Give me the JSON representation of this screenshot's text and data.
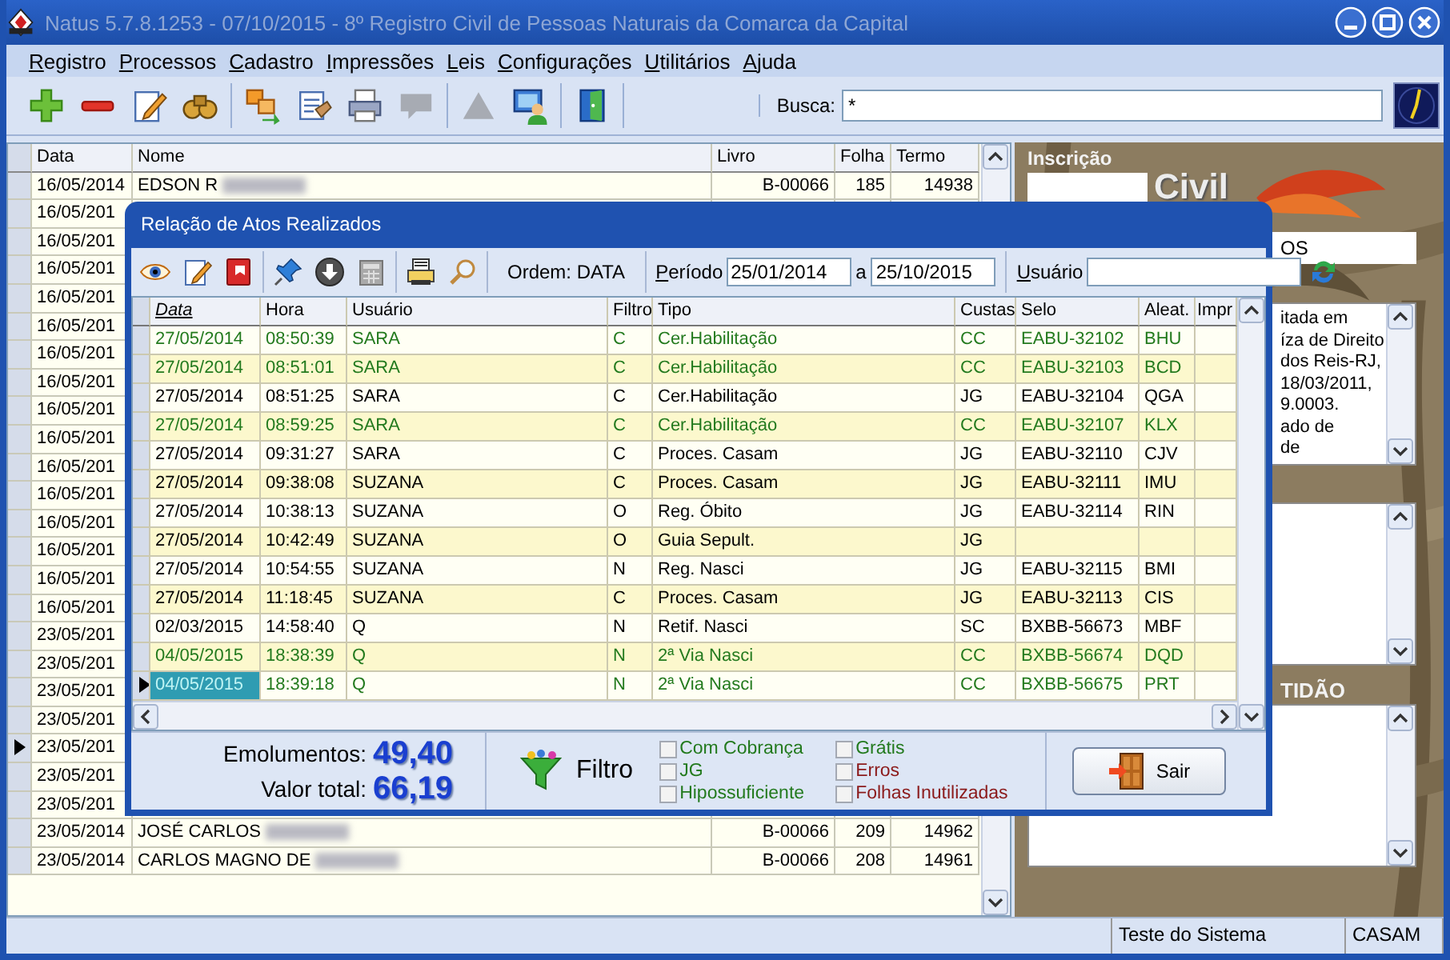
{
  "window": {
    "title": "Natus 5.7.8.1253 - 07/10/2015 - 8º Registro Civil de Pessoas Naturais da Comarca da Capital"
  },
  "menu": [
    {
      "label": "Registro"
    },
    {
      "label": "Processos"
    },
    {
      "label": "Cadastro"
    },
    {
      "label": "Impressões"
    },
    {
      "label": "Leis"
    },
    {
      "label": "Configurações"
    },
    {
      "label": "Utilitários"
    },
    {
      "label": "Ajuda"
    }
  ],
  "toolbar": [
    {
      "items": [
        {
          "kind": "add",
          "disabled": false
        },
        {
          "kind": "remove",
          "disabled": false
        },
        {
          "kind": "edit",
          "disabled": false
        },
        {
          "kind": "binoculars",
          "disabled": false
        }
      ]
    },
    {
      "items": [
        {
          "kind": "swap",
          "disabled": false
        },
        {
          "kind": "document",
          "disabled": false
        },
        {
          "kind": "printer",
          "disabled": false
        },
        {
          "kind": "speech",
          "disabled": true
        }
      ]
    },
    {
      "items": [
        {
          "kind": "triangle",
          "disabled": true
        },
        {
          "kind": "user",
          "disabled": false
        }
      ]
    },
    {
      "items": [
        {
          "kind": "door",
          "disabled": false
        }
      ]
    }
  ],
  "search": {
    "label": "Busca:",
    "value": "*"
  },
  "records_table": {
    "columns": [
      "Data",
      "Nome",
      "Livro",
      "Folha",
      "Termo"
    ],
    "rows": [
      {
        "cells": [
          "16/05/2014",
          "EDSON R",
          "B-00066",
          "185",
          "14938"
        ],
        "redacted": true,
        "selected": false
      },
      {
        "cells": [
          "16/05/201"
        ],
        "selected": false
      },
      {
        "cells": [
          "16/05/201"
        ],
        "selected": false
      },
      {
        "cells": [
          "16/05/201"
        ],
        "selected": false
      },
      {
        "cells": [
          "16/05/201"
        ],
        "selected": false
      },
      {
        "cells": [
          "16/05/201"
        ],
        "selected": false
      },
      {
        "cells": [
          "16/05/201"
        ],
        "selected": false
      },
      {
        "cells": [
          "16/05/201"
        ],
        "selected": false
      },
      {
        "cells": [
          "16/05/201"
        ],
        "selected": false
      },
      {
        "cells": [
          "16/05/201"
        ],
        "selected": false
      },
      {
        "cells": [
          "16/05/201"
        ],
        "selected": false
      },
      {
        "cells": [
          "16/05/201"
        ],
        "selected": false
      },
      {
        "cells": [
          "16/05/201"
        ],
        "selected": false
      },
      {
        "cells": [
          "16/05/201"
        ],
        "selected": false
      },
      {
        "cells": [
          "16/05/201"
        ],
        "selected": false
      },
      {
        "cells": [
          "16/05/201"
        ],
        "selected": false
      },
      {
        "cells": [
          "23/05/201"
        ],
        "selected": false
      },
      {
        "cells": [
          "23/05/201"
        ],
        "selected": false
      },
      {
        "cells": [
          "23/05/201"
        ],
        "selected": false
      },
      {
        "cells": [
          "23/05/201"
        ],
        "selected": false
      },
      {
        "cells": [
          "23/05/201"
        ],
        "selected": true
      },
      {
        "cells": [
          "23/05/201"
        ],
        "selected": false
      },
      {
        "cells": [
          "23/05/201"
        ],
        "selected": false
      },
      {
        "cells": [
          "23/05/2014",
          "JOSÉ CARLOS",
          "B-00066",
          "209",
          "14962"
        ],
        "redacted": true,
        "selected": false
      },
      {
        "cells": [
          "23/05/2014",
          "CARLOS MAGNO DE",
          "B-00066",
          "208",
          "14961"
        ],
        "redacted": true,
        "selected": false
      }
    ]
  },
  "details": {
    "label": "Inscrição",
    "heading": "Civil",
    "field_value": "OS",
    "notes_lines": [
      "itada em",
      "íza de Direito",
      "dos Reis-RJ,",
      "18/03/2011,",
      "9.0003.",
      "ado de",
      "de"
    ],
    "section_label": "TIDÃO"
  },
  "status_bar": [
    "Teste do Sistema",
    "CASAM"
  ],
  "dialog": {
    "title": "Relação de Atos Realizados",
    "toolbar": [
      {
        "items": [
          {
            "kind": "eye"
          },
          {
            "kind": "edit"
          },
          {
            "kind": "book"
          }
        ]
      },
      {
        "items": [
          {
            "kind": "pin"
          },
          {
            "kind": "down"
          },
          {
            "kind": "calculator"
          }
        ]
      },
      {
        "items": [
          {
            "kind": "printer2"
          },
          {
            "kind": "magnifier"
          }
        ]
      }
    ],
    "order_label": "Ordem: DATA",
    "period": {
      "label": "Período",
      "from": "25/01/2014",
      "separator": "a",
      "to": "25/10/2015"
    },
    "user": {
      "label": "Usuário"
    },
    "columns": [
      {
        "label": "Data",
        "sorted": true
      },
      {
        "label": "Hora",
        "sorted": false
      },
      {
        "label": "Usuário",
        "sorted": false
      },
      {
        "label": "Filtro",
        "sorted": false
      },
      {
        "label": "Tipo",
        "sorted": false
      },
      {
        "label": "Custas",
        "sorted": false
      },
      {
        "label": "Selo",
        "sorted": false
      },
      {
        "label": "Aleat.",
        "sorted": false
      },
      {
        "label": "Impr",
        "sorted": false
      }
    ],
    "rows": [
      {
        "cells": [
          "27/05/2014",
          "08:50:39",
          "SARA",
          "C",
          "Cer.Habilitação",
          "CC",
          "EABU-32102",
          "BHU"
        ],
        "color": "#237a1e",
        "selected": false
      },
      {
        "cells": [
          "27/05/2014",
          "08:51:01",
          "SARA",
          "C",
          "Cer.Habilitação",
          "CC",
          "EABU-32103",
          "BCD"
        ],
        "color": "#237a1e",
        "selected": false
      },
      {
        "cells": [
          "27/05/2014",
          "08:51:25",
          "SARA",
          "C",
          "Cer.Habilitação",
          "JG",
          "EABU-32104",
          "QGA"
        ],
        "color": "#000000",
        "selected": false
      },
      {
        "cells": [
          "27/05/2014",
          "08:59:25",
          "SARA",
          "C",
          "Cer.Habilitação",
          "CC",
          "EABU-32107",
          "KLX"
        ],
        "color": "#237a1e",
        "selected": false
      },
      {
        "cells": [
          "27/05/2014",
          "09:31:27",
          "SARA",
          "C",
          "Proces. Casam",
          "JG",
          "EABU-32110",
          "CJV"
        ],
        "color": "#000000",
        "selected": false
      },
      {
        "cells": [
          "27/05/2014",
          "09:38:08",
          "SUZANA",
          "C",
          "Proces. Casam",
          "JG",
          "EABU-32111",
          "IMU"
        ],
        "color": "#000000",
        "selected": false
      },
      {
        "cells": [
          "27/05/2014",
          "10:38:13",
          "SUZANA",
          "O",
          "Reg. Óbito",
          "JG",
          "EABU-32114",
          "RIN"
        ],
        "color": "#000000",
        "selected": false
      },
      {
        "cells": [
          "27/05/2014",
          "10:42:49",
          "SUZANA",
          "O",
          "Guia Sepult.",
          "JG",
          null,
          null
        ],
        "color": "#000000",
        "selected": false
      },
      {
        "cells": [
          "27/05/2014",
          "10:54:55",
          "SUZANA",
          "N",
          "Reg. Nasci",
          "JG",
          "EABU-32115",
          "BMI"
        ],
        "color": "#000000",
        "selected": false
      },
      {
        "cells": [
          "27/05/2014",
          "11:18:45",
          "SUZANA",
          "C",
          "Proces. Casam",
          "JG",
          "EABU-32113",
          "CIS"
        ],
        "color": "#000000",
        "selected": false
      },
      {
        "cells": [
          "02/03/2015",
          "14:58:40",
          "Q",
          "N",
          "Retif. Nasci",
          "SC",
          "BXBB-56673",
          "MBF"
        ],
        "color": "#000000",
        "selected": false
      },
      {
        "cells": [
          "04/05/2015",
          "18:38:39",
          "Q",
          "N",
          "2ª Via Nasci",
          "CC",
          "BXBB-56674",
          "DQD"
        ],
        "color": "#237a1e",
        "selected": false
      },
      {
        "cells": [
          "04/05/2015",
          "18:39:18",
          "Q",
          "N",
          "2ª Via Nasci",
          "CC",
          "BXBB-56675",
          "PRT"
        ],
        "color": "#237a1e",
        "selected": true
      }
    ],
    "totals": [
      {
        "label": "Emolumentos:",
        "value": "49,40"
      },
      {
        "label": "Valor total:",
        "value": "66,19"
      }
    ],
    "filter": {
      "label": "Filtro",
      "options": [
        {
          "label": "Com Cobrança",
          "checked": false,
          "color": "#237a1e"
        },
        {
          "label": "JG",
          "checked": false,
          "color": "#237a1e"
        },
        {
          "label": "Hipossuficiente",
          "checked": false,
          "color": "#237a1e"
        },
        {
          "label": "Grátis",
          "checked": false,
          "color": "#237a1e"
        },
        {
          "label": "Erros",
          "checked": false,
          "color": "#8b1a1a"
        },
        {
          "label": "Folhas Inutilizadas",
          "checked": false,
          "color": "#8b1a1a"
        }
      ]
    },
    "exit_button": "Sair"
  }
}
